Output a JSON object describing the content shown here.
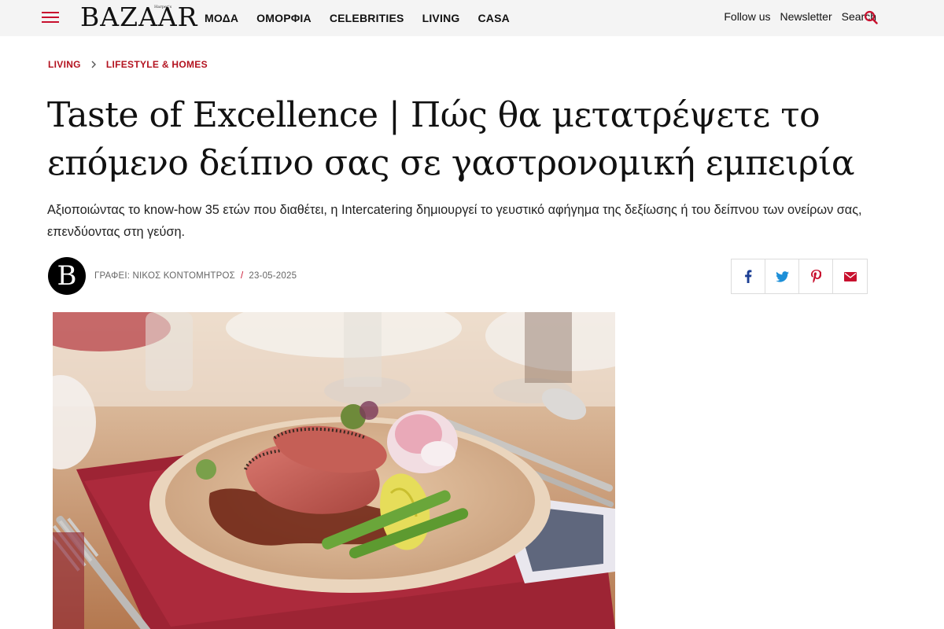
{
  "header": {
    "logo": "BAZAAR",
    "logo_small": "Harper's",
    "nav": [
      "ΜΟΔΑ",
      "ΟΜΟΡΦΙΑ",
      "CELEBRITIES",
      "LIVING",
      "CASA"
    ],
    "follow_label": "Follow us",
    "newsletter_label": "Newsletter",
    "search_label": "Search"
  },
  "breadcrumb": [
    "LIVING",
    "LIFESTYLE & HOMES"
  ],
  "article": {
    "title": "Taste of Excellence | Πώς θα μετατρέψετε το επόμενο δείπνο σας σε γαστρονομική εμπειρία",
    "dek": "Αξιοποιώντας το know-how 35 ετών που διαθέτει, η Intercatering δημιουργεί το γευστικό αφήγημα της δεξίωσης ή του δείπνου των ονείρων σας, επενδύοντας στη γεύση.",
    "avatar_letter": "B",
    "author": "ΓΡΑΦΕΙ: ΝΙΚΟΣ ΚΟΝΤΟΜΗΤΡΟΣ",
    "separator": "/",
    "date": "23-05-2025"
  },
  "share": [
    "facebook-icon",
    "twitter-icon",
    "pinterest-icon",
    "email-icon"
  ],
  "colors": {
    "accent": "#c8102e",
    "breadcrumb": "#b3121f",
    "nav_bg": "#f4f4f4"
  }
}
